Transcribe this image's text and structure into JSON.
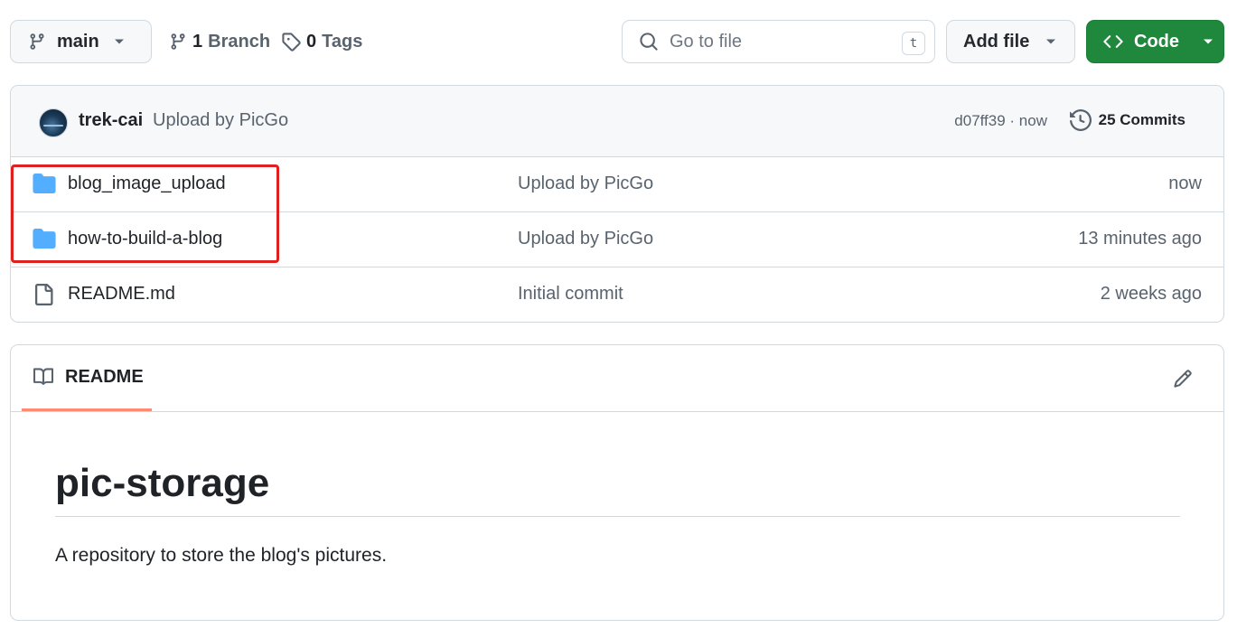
{
  "toolbar": {
    "branch": "main",
    "branches_count": "1",
    "branches_word": "Branch",
    "tags_count": "0",
    "tags_word": "Tags",
    "search_placeholder": "Go to file",
    "search_shortcut": "t",
    "add_file": "Add file",
    "code": "Code"
  },
  "latest_commit": {
    "author": "trek-cai",
    "message": "Upload by PicGo",
    "sha_time": "d07ff39 · now",
    "commits_label": "25 Commits"
  },
  "files": [
    {
      "name": "blog_image_upload",
      "message": "Upload by PicGo",
      "date": "now",
      "type": "folder"
    },
    {
      "name": "how-to-build-a-blog",
      "message": "Upload by PicGo",
      "date": "13 minutes ago",
      "type": "folder"
    },
    {
      "name": "README.md",
      "message": "Initial commit",
      "date": "2 weeks ago",
      "type": "file"
    }
  ],
  "readme": {
    "tab_label": "README",
    "title": "pic-storage",
    "description": "A repository to store the blog's pictures."
  },
  "colors": {
    "code_button": "#1f883d",
    "folder_icon": "#54aeff",
    "highlight": "#e0201e",
    "tab_underline": "#fd8c73"
  },
  "icons": [
    "branch-icon",
    "tag-icon",
    "search-icon",
    "caret-down-icon",
    "code-icon",
    "history-icon",
    "folder-icon",
    "file-icon",
    "book-icon",
    "pencil-icon"
  ]
}
